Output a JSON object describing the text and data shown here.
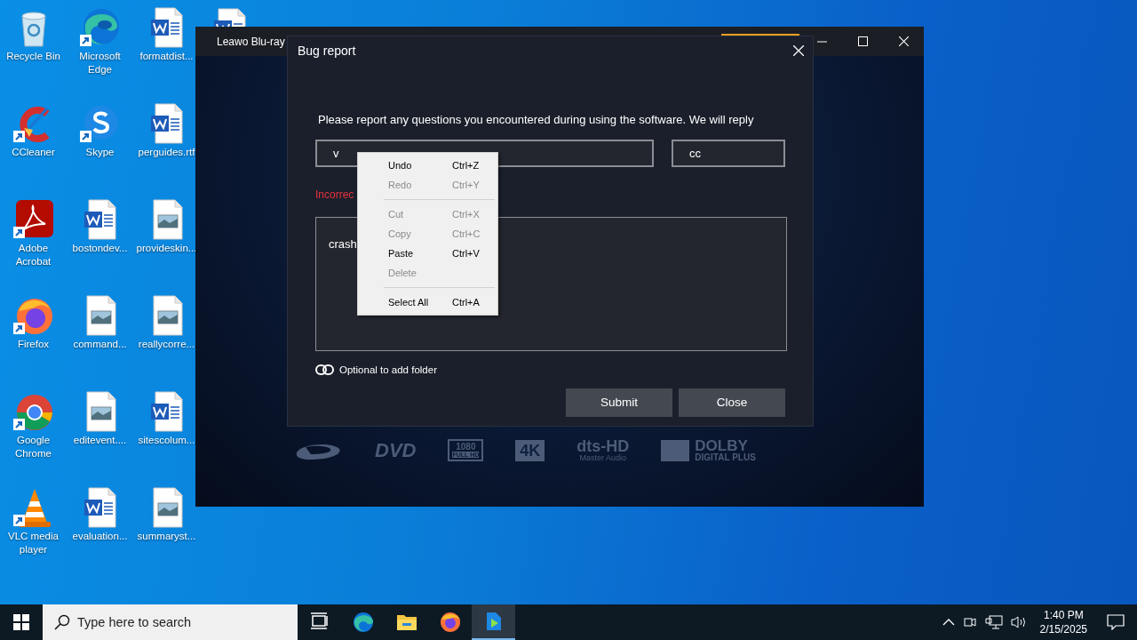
{
  "desktop_icons": [
    {
      "label": "Recycle Bin",
      "kind": "recycle",
      "shortcut": false
    },
    {
      "label": "CCleaner",
      "kind": "ccleaner",
      "shortcut": true
    },
    {
      "label": "Adobe Acrobat",
      "kind": "acrobat",
      "shortcut": true
    },
    {
      "label": "Firefox",
      "kind": "firefox",
      "shortcut": true
    },
    {
      "label": "Google Chrome",
      "kind": "chrome",
      "shortcut": true
    },
    {
      "label": "VLC media player",
      "kind": "vlc",
      "shortcut": true
    },
    {
      "label": "Microsoft Edge",
      "kind": "edge",
      "shortcut": true
    },
    {
      "label": "Skype",
      "kind": "skype",
      "shortcut": true
    },
    {
      "label": "bostondev...",
      "kind": "word",
      "shortcut": false
    },
    {
      "label": "command...",
      "kind": "image",
      "shortcut": false
    },
    {
      "label": "editevent....",
      "kind": "image",
      "shortcut": false
    },
    {
      "label": "evaluation...",
      "kind": "word",
      "shortcut": false
    },
    {
      "label": "formatdist...",
      "kind": "word",
      "shortcut": false
    },
    {
      "label": "perguides.rtf",
      "kind": "word",
      "shortcut": false
    },
    {
      "label": "provideskin...",
      "kind": "image",
      "shortcut": false
    },
    {
      "label": "reallycorre...",
      "kind": "image",
      "shortcut": false
    },
    {
      "label": "sitescolum...",
      "kind": "word",
      "shortcut": false
    },
    {
      "label": "summaryst...",
      "kind": "image",
      "shortcut": false
    }
  ],
  "partial_icon": {
    "kind": "word"
  },
  "app_window": {
    "title": "Leawo Blu-ray",
    "formats": [
      {
        "kind": "bluray"
      },
      {
        "kind": "dvd",
        "label": "DVD"
      },
      {
        "kind": "fullhd",
        "label": "1080",
        "sub": "FULL HD"
      },
      {
        "kind": "uhd",
        "label": "4K"
      },
      {
        "kind": "dts",
        "label": "dts-HD",
        "sub": "Master Audio"
      },
      {
        "kind": "dolby",
        "label": "DOLBY",
        "sub": "DIGITAL PLUS"
      }
    ]
  },
  "dialog": {
    "title": "Bug report",
    "message": "Please report any questions you encountered during using the software. We will reply",
    "fields": [
      {
        "value": "v"
      },
      {
        "value": "cc"
      }
    ],
    "error": "Incorrec",
    "description": {
      "value": "crash"
    },
    "attach_label": "Optional to add folder",
    "buttons": [
      "Submit",
      "Close"
    ]
  },
  "context_menu": {
    "items": [
      {
        "kind": "item",
        "label": "Undo",
        "shortcut": "Ctrl+Z",
        "disabled": false
      },
      {
        "kind": "item",
        "label": "Redo",
        "shortcut": "Ctrl+Y",
        "disabled": true
      },
      {
        "kind": "separator"
      },
      {
        "kind": "item",
        "label": "Cut",
        "shortcut": "Ctrl+X",
        "disabled": true
      },
      {
        "kind": "item",
        "label": "Copy",
        "shortcut": "Ctrl+C",
        "disabled": true
      },
      {
        "kind": "item",
        "label": "Paste",
        "shortcut": "Ctrl+V",
        "disabled": false
      },
      {
        "kind": "item",
        "label": "Delete",
        "disabled": true
      },
      {
        "kind": "separator"
      },
      {
        "kind": "item",
        "label": "Select All",
        "shortcut": "Ctrl+A",
        "disabled": false
      }
    ]
  },
  "taskbar": {
    "search": {
      "placeholder": "Type here to search"
    },
    "apps": [
      {
        "kind": "taskview",
        "active": false
      },
      {
        "kind": "edge",
        "active": false
      },
      {
        "kind": "explorer",
        "active": false
      },
      {
        "kind": "firefox",
        "active": false
      },
      {
        "kind": "leawo",
        "active": true
      }
    ],
    "tray": {
      "time": "1:40 PM",
      "date": "2/15/2025"
    }
  }
}
